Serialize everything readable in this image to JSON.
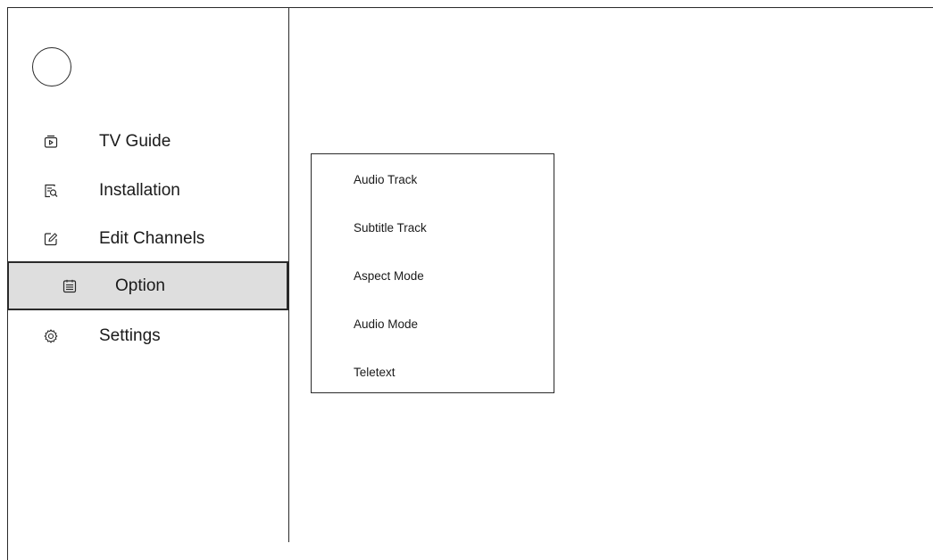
{
  "sidebar": {
    "items": [
      {
        "label": "TV Guide",
        "icon": "tv-guide-icon"
      },
      {
        "label": "Installation",
        "icon": "installation-search-icon"
      },
      {
        "label": "Edit Channels",
        "icon": "edit-icon"
      },
      {
        "label": "Option",
        "icon": "option-list-icon",
        "selected": true
      },
      {
        "label": "Settings",
        "icon": "gear-icon"
      }
    ]
  },
  "option_panel": {
    "items": [
      {
        "label": "Audio Track"
      },
      {
        "label": "Subtitle Track"
      },
      {
        "label": "Aspect Mode"
      },
      {
        "label": "Audio Mode"
      },
      {
        "label": "Teletext"
      }
    ]
  },
  "colors": {
    "selected_background": "#dedede",
    "border": "#2a2a2a"
  }
}
